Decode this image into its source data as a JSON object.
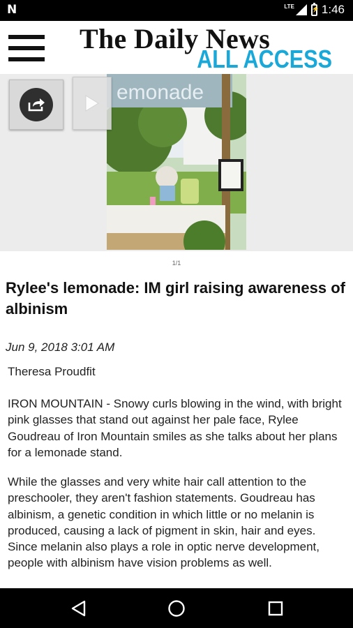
{
  "status_bar": {
    "network_label": "LTE",
    "time": "1:46"
  },
  "header": {
    "masthead_title": "The Daily News",
    "masthead_subtitle": "ALL ACCESS",
    "accent_color": "#1aa8d8"
  },
  "gallery": {
    "sign_text": "emonade",
    "counter": "1/1",
    "icons": [
      "share-icon",
      "play-icon"
    ]
  },
  "article": {
    "headline": "Rylee's lemonade: IM girl raising awareness of albinism",
    "date": "Jun 9, 2018 3:01 AM",
    "author": "Theresa Proudfit",
    "paragraphs": [
      "IRON MOUNTAIN - Snowy curls blowing in the wind, with bright pink glasses that stand out against her pale face, Rylee Goudreau of Iron Mountain smiles as she talks about her plans for a lemonade stand.",
      "While the glasses and very white hair call attention to the preschooler, they aren't fashion statements. Goudreau has albinism, a genetic condition in which little or no melanin is produced, causing a lack of pigment in skin, hair and eyes. Since melanin also plays a role in optic nerve development, people with albinism have vision problems as well."
    ]
  },
  "nav_bar": {
    "icons": [
      "back-icon",
      "home-icon",
      "recents-icon"
    ]
  }
}
